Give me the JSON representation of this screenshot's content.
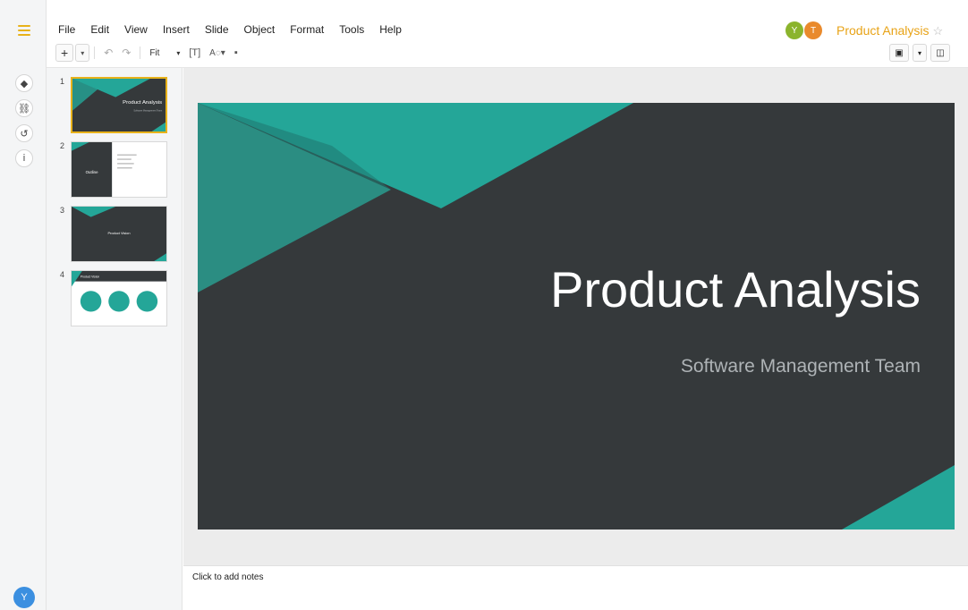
{
  "menu": [
    "File",
    "Edit",
    "View",
    "Insert",
    "Slide",
    "Object",
    "Format",
    "Tools",
    "Help"
  ],
  "toolbar": {
    "zoom_label": "Fit"
  },
  "collaborators": [
    {
      "initial": "Y",
      "color": "#8bb42d"
    },
    {
      "initial": "T",
      "color": "#e98a2c"
    }
  ],
  "document": {
    "title": "Product Analysis",
    "star": "☆"
  },
  "rail": {
    "avatar_initial": "Y"
  },
  "slides": [
    {
      "number": "1",
      "title": "Product Analysis",
      "subtitle": "Software Management Team"
    },
    {
      "number": "2",
      "title": "Outline"
    },
    {
      "number": "3",
      "title": "Product Vision"
    },
    {
      "number": "4",
      "title": "Product Vision"
    }
  ],
  "notes": {
    "placeholder": "Click to add notes"
  },
  "colors": {
    "accent": "#e8b21a",
    "teal": "#24a698",
    "slide_bg": "#35393b"
  }
}
